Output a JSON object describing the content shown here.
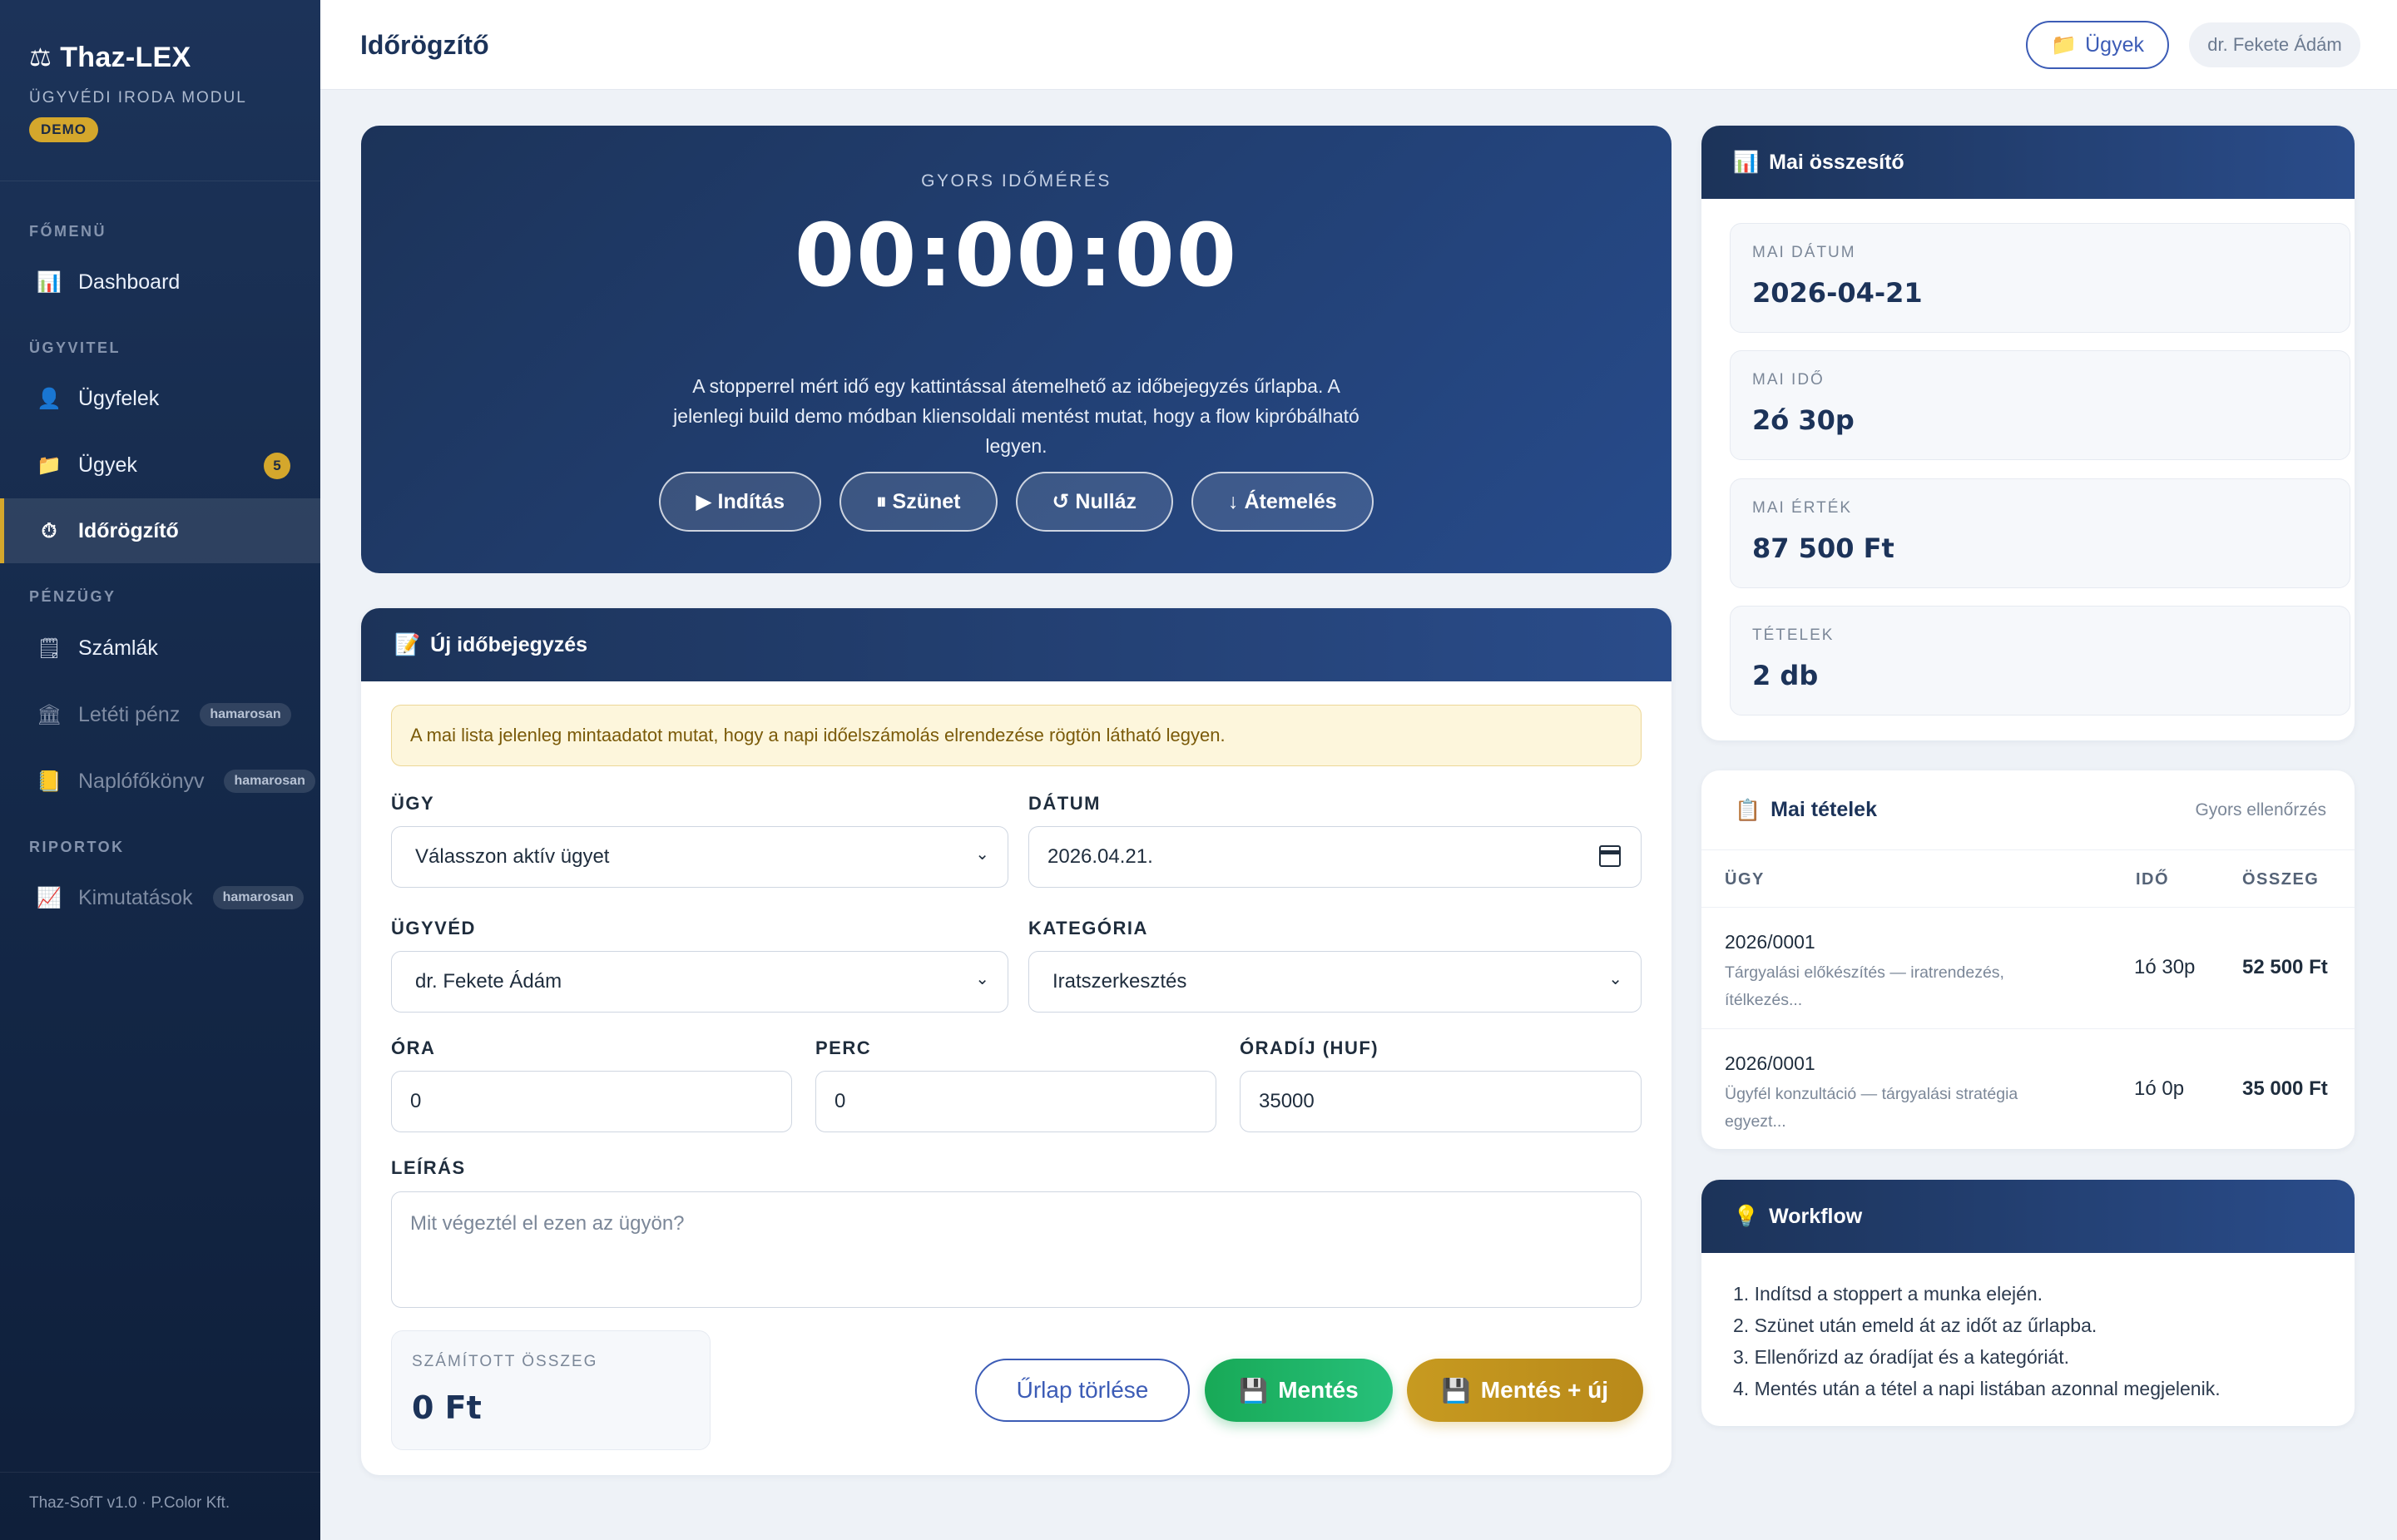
{
  "sidebar": {
    "brand": {
      "icon": "scale-icon",
      "title": "Thaz-LEX",
      "subtitle": "ÜGYVÉDI IRODA MODUL",
      "badge": "DEMO"
    },
    "sections": [
      {
        "label": "FŐMENÜ"
      },
      {
        "label": "ÜGYVITEL"
      },
      {
        "label": "PÉNZÜGY"
      },
      {
        "label": "RIPORTOK"
      }
    ],
    "items": [
      {
        "label": "Dashboard",
        "icon": "chart-icon"
      },
      {
        "label": "Ügyfelek",
        "icon": "user-icon"
      },
      {
        "label": "Ügyek",
        "icon": "folder-icon",
        "count": "5"
      },
      {
        "label": "Időrögzítő",
        "icon": "stopwatch-icon"
      },
      {
        "label": "Számlák",
        "icon": "invoice-icon"
      },
      {
        "label": "Letéti pénz",
        "icon": "bank-icon",
        "badge": "hamarosan"
      },
      {
        "label": "Naplófőkönyv",
        "icon": "ledger-icon",
        "badge": "hamarosan"
      },
      {
        "label": "Kimutatások",
        "icon": "trend-chart-icon",
        "badge": "hamarosan"
      }
    ],
    "footer": "Thaz-SofT v1.0 · P.Color Kft."
  },
  "header": {
    "title": "Időrögzítő",
    "cases_button": "Ügyek",
    "user": "dr. Fekete Ádám"
  },
  "timer": {
    "label": "GYORS IDŐMÉRÉS",
    "value": "00:00:00",
    "description": "A stopperrel mért idő egy kattintással átemelhető az időbejegyzés űrlapba. A jelenlegi build demo módban kliensoldali mentést mutat, hogy a flow kipróbálható legyen.",
    "buttons": {
      "start": "▶ Indítás",
      "pause": "⏸ Szünet",
      "reset": "↺ Nulláz",
      "transfer": "↓ Átemelés"
    }
  },
  "entry_form": {
    "title": "Új időbejegyzés",
    "alert": "A mai lista jelenleg mintaadatot mutat, hogy a napi időelszámolás elrendezése rögtön látható legyen.",
    "case_label": "ÜGY",
    "case_value": "Válasszon aktív ügyet",
    "date_label": "DÁTUM",
    "date_value": "2026.04.21.",
    "lawyer_label": "ÜGYVÉD",
    "lawyer_value": "dr. Fekete Ádám",
    "category_label": "KATEGÓRIA",
    "category_value": "Iratszerkesztés",
    "hours_label": "ÓRA",
    "hours_value": "0",
    "minutes_label": "PERC",
    "minutes_value": "0",
    "rate_label": "ÓRADÍJ (HUF)",
    "rate_value": "35000",
    "description_label": "LEÍRÁS",
    "description_placeholder": "Mit végeztél el ezen az ügyön?",
    "computed_label": "SZÁMÍTOTT ÖSSZEG",
    "computed_value": "0 Ft",
    "clear_button": "Űrlap törlése",
    "save_button": "Mentés",
    "save_new_button": "Mentés + új"
  },
  "summary": {
    "title": "Mai összesítő",
    "stats": [
      {
        "label": "MAI DÁTUM",
        "value": "2026-04-21"
      },
      {
        "label": "MAI IDŐ",
        "value": "2ó 30p"
      },
      {
        "label": "MAI ÉRTÉK",
        "value": "87 500 Ft"
      },
      {
        "label": "TÉTELEK",
        "value": "2 db"
      }
    ]
  },
  "items": {
    "title": "Mai tételek",
    "hint": "Gyors ellenőrzés",
    "columns": [
      "ÜGY",
      "IDŐ",
      "ÖSSZEG"
    ],
    "rows": [
      {
        "case": "2026/0001",
        "desc": "Tárgyalási előkészítés — iratrendezés, ítélkezés...",
        "time": "1ó 30p",
        "amount": "52 500 Ft"
      },
      {
        "case": "2026/0001",
        "desc": "Ügyfél konzultáció — tárgyalási stratégia egyezt...",
        "time": "1ó 0p",
        "amount": "35 000 Ft"
      }
    ]
  },
  "workflow": {
    "title": "Workflow",
    "steps": [
      "1. Indítsd a stoppert a munka elején.",
      "2. Szünet után emeld át az időt az űrlapba.",
      "3. Ellenőrizd az óradíjat és a kategóriát.",
      "4. Mentés után a tétel a napi listában azonnal megjelenik."
    ]
  },
  "colors": {
    "navy": "#1c3359",
    "accent": "#3c5cb6",
    "gold": "#d4a72c",
    "green": "#18a957"
  }
}
